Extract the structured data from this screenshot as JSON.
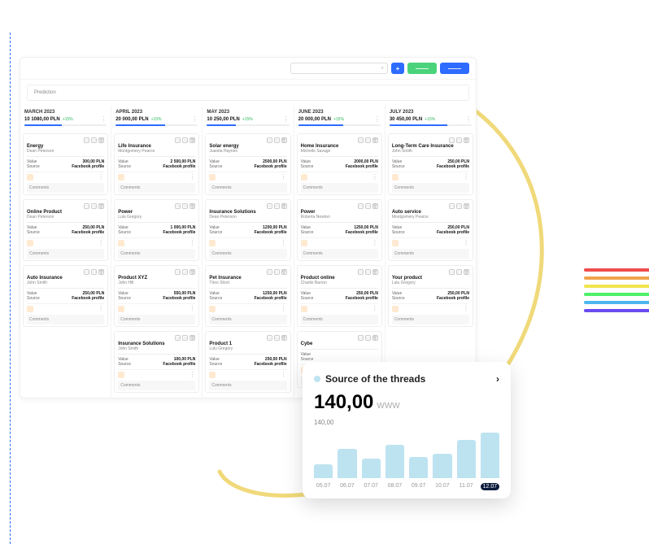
{
  "header": {
    "search_placeholder": "",
    "add_label": "+",
    "btn2": "——",
    "btn3": "——"
  },
  "prediction_label": "Prediction",
  "labels": {
    "value": "Value",
    "source": "Source",
    "comments": "Comments"
  },
  "columns": [
    {
      "title": "MARCH 2023",
      "total": "10 1080,00 PLN",
      "delta": "+15%",
      "progress": 45,
      "cards": [
        {
          "title": "Energy",
          "person": "Dean Peterson",
          "value": "300,00 PLN",
          "source": "Facebook profile"
        },
        {
          "title": "Online Product",
          "person": "Dean Peterson",
          "value": "250,00 PLN",
          "source": "Facebook profile"
        },
        {
          "title": "Auto Insurance",
          "person": "John Smith",
          "value": "250,00 PLN",
          "source": "Facebook profile"
        }
      ]
    },
    {
      "title": "APRIL 2023",
      "total": "20 000,00 PLN",
      "delta": "+15%",
      "progress": 60,
      "cards": [
        {
          "title": "Life Insurance",
          "person": "Montgomery Pearce",
          "value": "2 500,00 PLN",
          "source": "Facebook profile"
        },
        {
          "title": "Power",
          "person": "Lulu Gregory",
          "value": "1 000,00 PLN",
          "source": "Facebook profile"
        },
        {
          "title": "Product XYZ",
          "person": "John Hill",
          "value": "550,00 PLN",
          "source": "Facebook profile"
        },
        {
          "title": "Insurance Solutions",
          "person": "John Smith",
          "value": "100,00 PLN",
          "source": "Facebook profile"
        }
      ]
    },
    {
      "title": "MAY 2023",
      "total": "10 250,00 PLN",
      "delta": "+15%",
      "progress": 35,
      "cards": [
        {
          "title": "Solar energy",
          "person": "Juanita Haynes",
          "value": "2500,00 PLN",
          "source": "Facebook profile"
        },
        {
          "title": "Insurance Solutions",
          "person": "Dean Peterson",
          "value": "1200,00 PLN",
          "source": "Facebook profile"
        },
        {
          "title": "Pet Insurance",
          "person": "Theo Short",
          "value": "1250,00 PLN",
          "source": "Facebook profile"
        },
        {
          "title": "Product 1",
          "person": "Lulu Gregory",
          "value": "250,00 PLN",
          "source": "Facebook profile"
        }
      ]
    },
    {
      "title": "JUNE 2023",
      "total": "20 000,00 PLN",
      "delta": "+15%",
      "progress": 55,
      "cards": [
        {
          "title": "Home Insurance",
          "person": "Michelle Savage",
          "value": "2000,00 PLN",
          "source": "Facebook profile"
        },
        {
          "title": "Power",
          "person": "Roberta Newton",
          "value": "1250,00 PLN",
          "source": "Facebook profile"
        },
        {
          "title": "Product online",
          "person": "Charlie Barron",
          "value": "250,00 PLN",
          "source": "Facebook profile"
        },
        {
          "title": "Cybe",
          "person": "",
          "value": "",
          "source": ""
        }
      ]
    },
    {
      "title": "JULY 2023",
      "total": "30 450,00 PLN",
      "delta": "+15%",
      "progress": 70,
      "cards": [
        {
          "title": "Long-Term Care Insurance",
          "person": "John Smith",
          "value": "250,00 PLN",
          "source": "Facebook profile"
        },
        {
          "title": "Auto service",
          "person": "Montgomery Pearce",
          "value": "250,00 PLN",
          "source": "Facebook profile"
        },
        {
          "title": "Your product",
          "person": "Lulu Gregory",
          "value": "250,00 PLN",
          "source": "Facebook profile"
        }
      ]
    }
  ],
  "widget": {
    "title": "Source of the threads",
    "value": "140,00",
    "unit": "WWW",
    "ymax": "140,00"
  },
  "chart_data": {
    "type": "bar",
    "title": "Source of the threads",
    "xlabel": "",
    "ylabel": "",
    "ylim": [
      0,
      140
    ],
    "categories": [
      "05.07",
      "06.07",
      "07.07",
      "08.07",
      "09.07",
      "10.07",
      "11.07",
      "12.07"
    ],
    "values": [
      40,
      85,
      55,
      95,
      60,
      70,
      110,
      130
    ],
    "highlight_index": 7
  },
  "stripe_colors": [
    "#f04d4d",
    "#f0a44d",
    "#f0e44d",
    "#4df06a",
    "#4db8f0",
    "#6a4df0"
  ]
}
